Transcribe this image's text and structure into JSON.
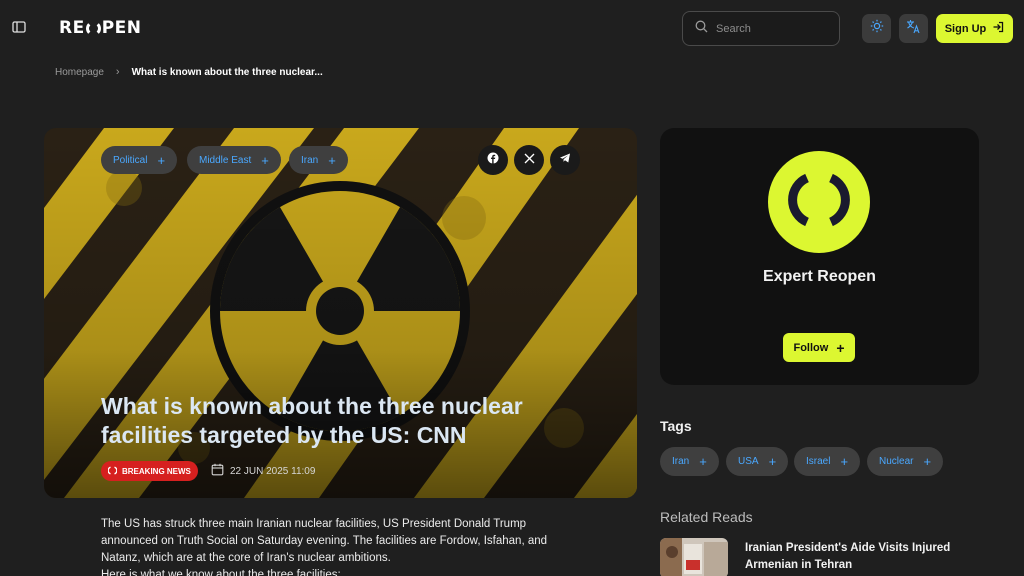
{
  "header": {
    "logo_left": "RE",
    "logo_right": "PEN",
    "search_placeholder": "Search",
    "signup_label": "Sign Up"
  },
  "breadcrumb": {
    "home": "Homepage",
    "separator": "›",
    "current": "What is known about the three nuclear..."
  },
  "hero": {
    "categories": [
      {
        "label": "Political"
      },
      {
        "label": "Middle East"
      },
      {
        "label": "Iran"
      }
    ],
    "share_icons": [
      "facebook-icon",
      "x-icon",
      "telegram-icon"
    ],
    "title": "What is known about the three nuclear facilities targeted by the US: CNN",
    "badge": "BREAKING NEWS",
    "date": "22 JUN 2025 11:09"
  },
  "article": {
    "paragraph": "The US has struck three main Iranian nuclear facilities, US President Donald Trump announced on Truth Social on Saturday evening. The facilities are Fordow, Isfahan, and Natanz, which are at the core of Iran's nuclear ambitions.",
    "paragraph2": "Here is what we know about the three facilities:"
  },
  "expert": {
    "name": "Expert Reopen",
    "follow_label": "Follow"
  },
  "tags": {
    "heading": "Tags",
    "items": [
      {
        "label": "Iran"
      },
      {
        "label": "USA"
      },
      {
        "label": "Israel"
      },
      {
        "label": "Nuclear"
      }
    ]
  },
  "related": {
    "heading": "Related Reads",
    "items": [
      {
        "title": "Iranian President's Aide Visits Injured Armenian in Tehran"
      }
    ]
  },
  "colors": {
    "accent": "#dcf731",
    "link_blue": "#4aa8ff",
    "breaking_red": "#d6201f",
    "background": "#1f1f1f"
  }
}
